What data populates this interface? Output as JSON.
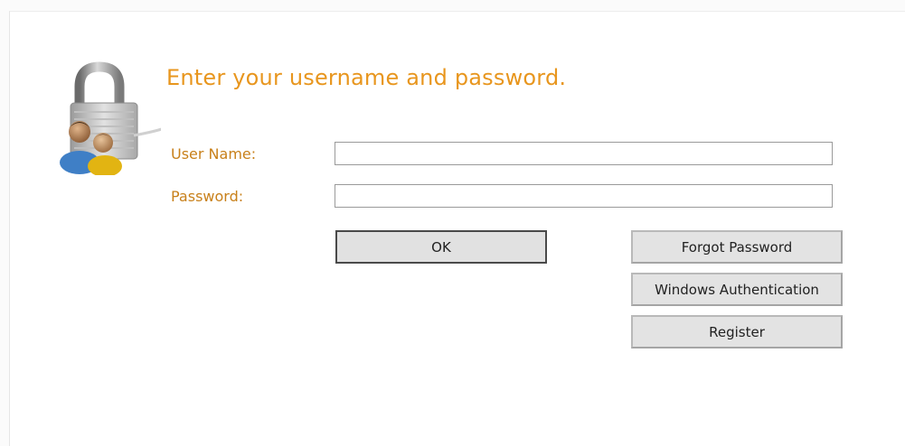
{
  "login": {
    "heading": "Enter your username and password.",
    "username_label": "User Name:",
    "username_value": "",
    "password_label": "Password:",
    "password_value": "",
    "ok_label": "OK",
    "forgot_password_label": "Forgot Password",
    "windows_auth_label": "Windows Authentication",
    "register_label": "Register"
  },
  "icons": {
    "lock": "lock-users-icon"
  },
  "colors": {
    "heading": "#e8961e",
    "label": "#c8801a",
    "button_bg": "#e3e3e3"
  }
}
